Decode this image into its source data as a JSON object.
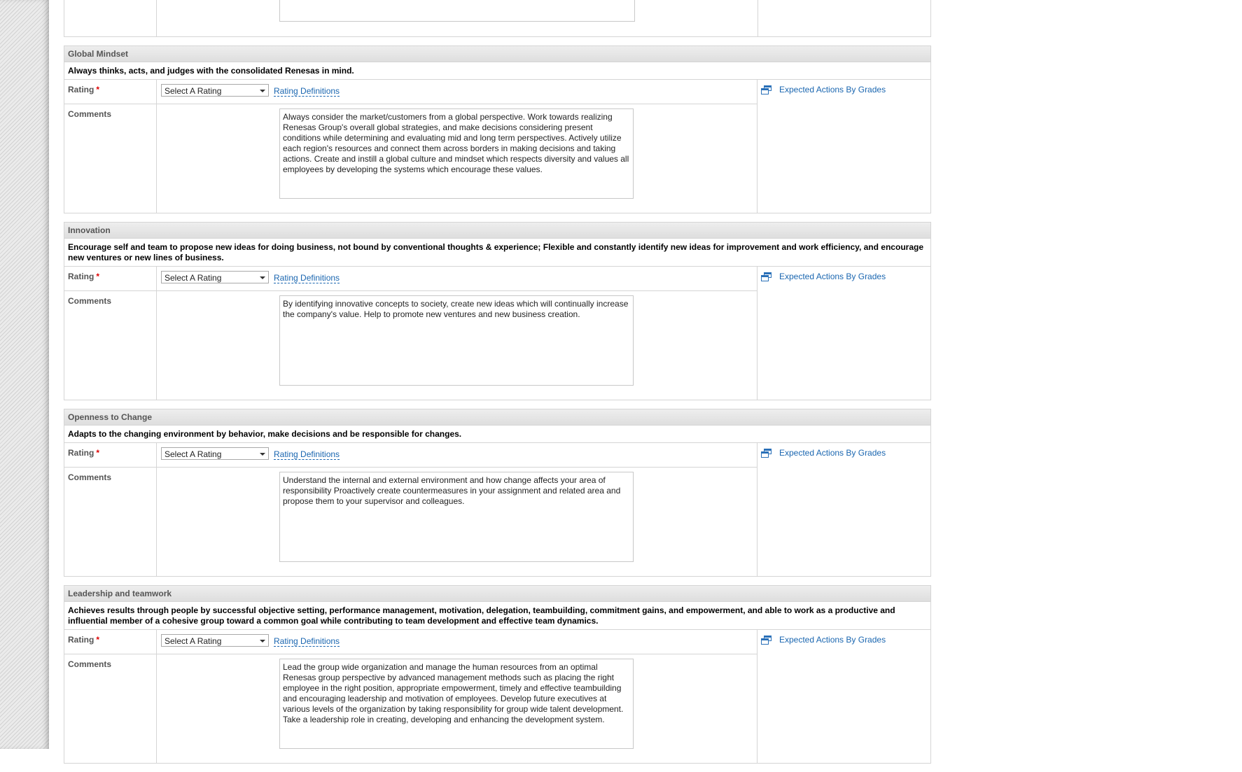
{
  "labels": {
    "rating": "Rating",
    "required_mark": "*",
    "comments": "Comments",
    "select_placeholder": "Select A Rating",
    "rating_definitions": "Rating Definitions",
    "expected_actions": "Expected Actions By Grades"
  },
  "competencies": [
    {
      "title": "Global Mindset",
      "description": "Always thinks, acts, and judges with the consolidated Renesas in mind.",
      "comment": "Always consider the market/customers from a global perspective. Work towards realizing Renesas Group's overall global strategies, and make decisions considering present conditions while determining and evaluating mid and long term perspectives. Actively utilize each region's resources and connect them across borders in making decisions and taking actions. Create and instill a global culture and mindset which respects diversity and values all employees by developing the systems which encourage these values."
    },
    {
      "title": "Innovation",
      "description": "Encourage self and team to propose new ideas for doing business, not bound by conventional thoughts & experience; Flexible and constantly identify new ideas for improvement and work efficiency, and encourage new ventures or new lines of business.",
      "comment": "By identifying innovative concepts to society, create new ideas which will continually increase the company's value. Help to promote new ventures and new business creation."
    },
    {
      "title": "Openness to Change",
      "description": "Adapts to the changing environment by behavior, make decisions and be responsible for changes.",
      "comment": "Understand the internal and external environment and how change affects your area of responsibility Proactively create countermeasures in your assignment and related area and propose them to your supervisor and colleagues."
    },
    {
      "title": "Leadership and teamwork",
      "description": "Achieves results through people by successful objective setting, performance management, motivation, delegation, teambuilding, commitment gains, and empowerment, and able to work as a productive and influential member of a cohesive group toward a common goal while contributing to team development and effective team dynamics.",
      "comment": "Lead the group wide organization and manage the human resources from an optimal Renesas group perspective by advanced management methods such as placing the right employee in the right position, appropriate empowerment, timely and effective teambuilding and encouraging leadership and motivation of employees. Develop future executives at various levels of the organization by taking responsibility for group wide talent development. Take a leadership role in creating, developing and enhancing the development system."
    }
  ]
}
